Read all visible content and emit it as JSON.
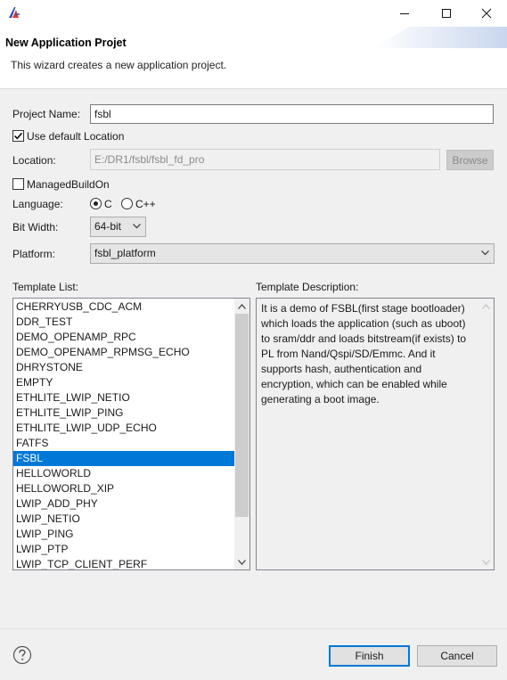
{
  "window": {
    "icon": "app-logo-icon",
    "controls": {
      "minimize": "minimize-icon",
      "maximize": "maximize-icon",
      "close": "close-icon"
    }
  },
  "header": {
    "title": "New Application Projet",
    "description": "This wizard creates a new application project."
  },
  "form": {
    "project_name_label": "Project Name:",
    "project_name_value": "fsbl",
    "use_default_label": "Use default Location",
    "use_default_checked": true,
    "location_label": "Location:",
    "location_value": "E:/DR1/fsbl/fsbl_fd_pro",
    "browse_label": "Browse",
    "managed_build_label": "ManagedBuildOn",
    "managed_build_checked": false,
    "language_label": "Language:",
    "language_options": [
      "C",
      "C++"
    ],
    "language_selected": "C",
    "bit_width_label": "Bit Width:",
    "bit_width_value": "64-bit",
    "platform_label": "Platform:",
    "platform_value": "fsbl_platform"
  },
  "templates": {
    "list_label": "Template List:",
    "description_label": "Template Description:",
    "items": [
      "CHERRYUSB_CDC_ACM",
      "DDR_TEST",
      "DEMO_OPENAMP_RPC",
      "DEMO_OPENAMP_RPMSG_ECHO",
      "DHRYSTONE",
      "EMPTY",
      "ETHLITE_LWIP_NETIO",
      "ETHLITE_LWIP_PING",
      "ETHLITE_LWIP_UDP_ECHO",
      "FATFS",
      "FSBL",
      "HELLOWORLD",
      "HELLOWORLD_XIP",
      "LWIP_ADD_PHY",
      "LWIP_NETIO",
      "LWIP_PING",
      "LWIP_PTP",
      "LWIP_TCP_CLIENT_PERF"
    ],
    "selected": "FSBL",
    "description": "It is a demo of FSBL(first stage bootloader) which loads the application (such as uboot) to sram/ddr and loads bitstream(if exists) to PL from Nand/Qspi/SD/Emmc. And it supports hash, authentication and encryption, which can be enabled while generating a boot image."
  },
  "footer": {
    "help_icon": "help-icon",
    "finish_label": "Finish",
    "cancel_label": "Cancel"
  },
  "colors": {
    "selection": "#0078d7",
    "dialog_bg": "#f0f0f0",
    "header_bg": "#ffffff"
  }
}
